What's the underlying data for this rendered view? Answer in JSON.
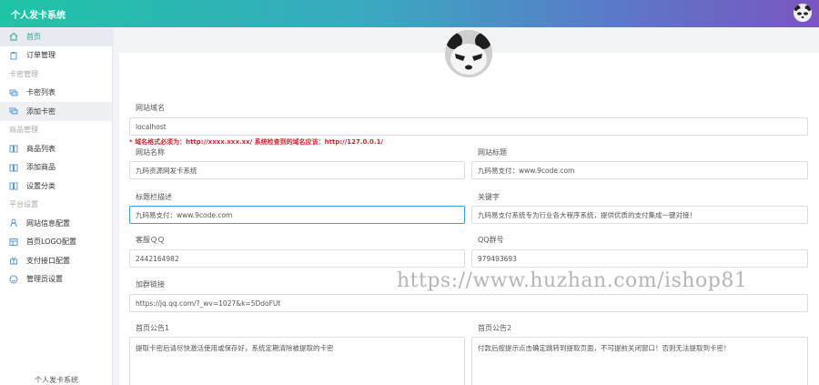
{
  "app": {
    "title": "个人发卡系统",
    "footer": "个人发卡系统"
  },
  "sidebar": {
    "items": [
      {
        "type": "item",
        "label": "首页",
        "icon": "home-icon",
        "state": "active"
      },
      {
        "type": "item",
        "label": "订单管理",
        "icon": "clipboard-icon"
      },
      {
        "type": "section",
        "label": "卡密管理"
      },
      {
        "type": "item",
        "label": "卡密列表",
        "icon": "card-stack-icon"
      },
      {
        "type": "item",
        "label": "添加卡密",
        "icon": "card-add-icon",
        "state": "highlight"
      },
      {
        "type": "section",
        "label": "商品管理"
      },
      {
        "type": "item",
        "label": "商品列表",
        "icon": "book-icon"
      },
      {
        "type": "item",
        "label": "添加商品",
        "icon": "book-add-icon"
      },
      {
        "type": "item",
        "label": "设置分类",
        "icon": "category-icon"
      },
      {
        "type": "section",
        "label": "平台设置"
      },
      {
        "type": "item",
        "label": "网站信息配置",
        "icon": "person-icon"
      },
      {
        "type": "item",
        "label": "首页LOGO配置",
        "icon": "layout-icon"
      },
      {
        "type": "item",
        "label": "支付接口配置",
        "icon": "gift-icon"
      },
      {
        "type": "item",
        "label": "管理员设置",
        "icon": "smile-icon"
      }
    ]
  },
  "form": {
    "domain": {
      "label": "网站域名",
      "value": "localhost"
    },
    "hint": "* 域名格式必须为：http://xxxx.xxx.xx/ 系统检查到的域名应该：http://127.0.0.1/",
    "site_name": {
      "label": "网站名称",
      "value": "九码资源网发卡系统"
    },
    "site_title": {
      "label": "网站标题",
      "value": "九码易支付：www.9code.com"
    },
    "title_desc": {
      "label": "标题栏描述",
      "value": "九码易支付：www.9code.com"
    },
    "keywords": {
      "label": "关键字",
      "value": "九码易支付系统专为行业各大程序系统，提供优质的支付集成一键对接！"
    },
    "qq": {
      "label": "客服ＱＱ",
      "value": "2442164982"
    },
    "qq_group": {
      "label": "QQ群号",
      "value": "979493693"
    },
    "group_link": {
      "label": "加群链接",
      "value": "https://jq.qq.com/?_wv=1027&k=5DdoFUt"
    },
    "notice1": {
      "label": "首页公告1",
      "value": "提取卡密后请尽快激活使用或保存好，系统定期清除被提取的卡密"
    },
    "notice2": {
      "label": "首页公告2",
      "value": "付款后按提示点击确定跳转到提取页面，不可提前关闭窗口！否则无法提取到卡密！"
    }
  },
  "watermark": "https://www.huzhan.com/ishop81",
  "colors": {
    "accent": "#2aa58d",
    "hint": "#d9232f",
    "focus": "#3aa0e6"
  }
}
